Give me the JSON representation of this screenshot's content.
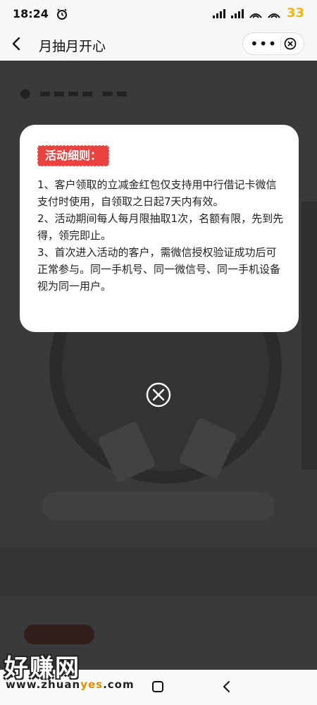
{
  "status_bar": {
    "time": "18:24",
    "battery": "33"
  },
  "titlebar": {
    "title": "月抽月开心",
    "more_label": "•••"
  },
  "dialog": {
    "heading": "活动细则：",
    "rules": [
      "1、客户领取的立减金红包仅支持用中行借记卡微信支付时使用，自领取之日起7天内有效。",
      "2、活动期间每人每月限抽取1次，名额有限，先到先得，领完即止。",
      "3、首次进入活动的客户，需微信授权验证成功后可正常参与。同一手机号、同一微信号、同一手机设备视为同一用户。"
    ]
  },
  "watermark": {
    "title": "好赚网",
    "url_prefix": "www.zhuan",
    "url_highlight": "yes",
    "url_suffix": ".com"
  },
  "icons": {
    "back": "back-arrow-icon",
    "close": "circle-close-icon",
    "home": "home-square-icon",
    "nav_back": "nav-back-icon",
    "alarm": "alarm-icon",
    "signal": "signal-icon",
    "wifi": "wifi-icon"
  },
  "colors": {
    "accent": "#e9423f",
    "battery": "#f2b705"
  }
}
